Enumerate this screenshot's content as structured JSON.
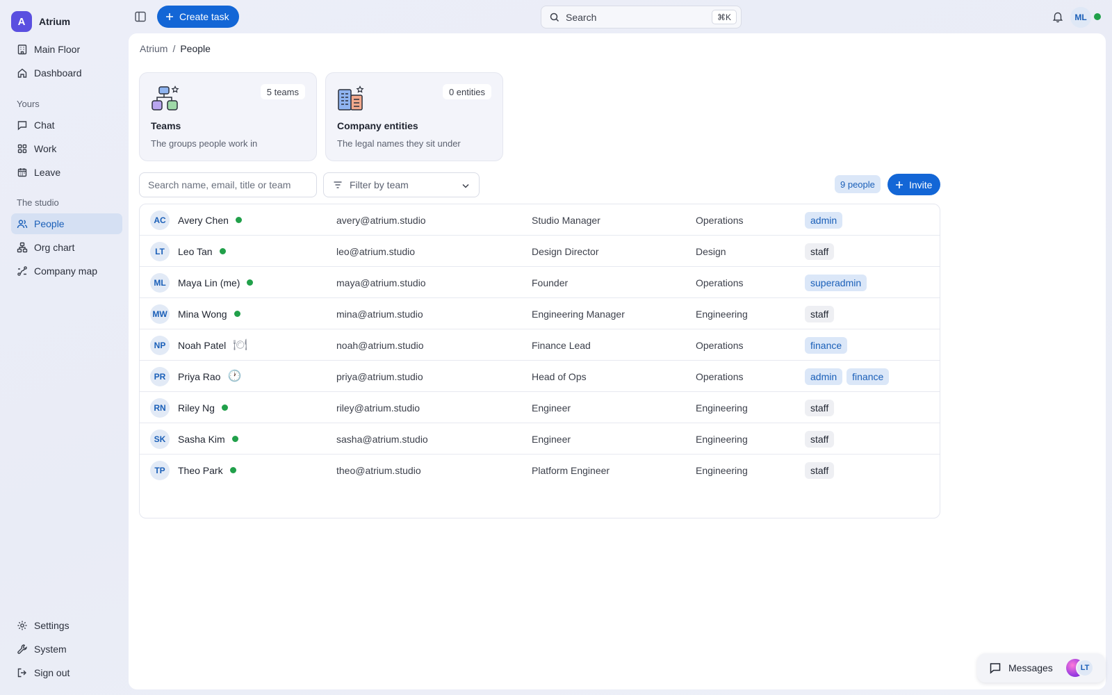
{
  "app": {
    "logo_letter": "A",
    "name": "Atrium"
  },
  "sidebar": {
    "top_items": [
      {
        "label": "Main Floor",
        "icon": "building-icon"
      },
      {
        "label": "Dashboard",
        "icon": "home-icon"
      }
    ],
    "section_yours": "Yours",
    "yours_items": [
      {
        "label": "Chat",
        "icon": "chat-icon"
      },
      {
        "label": "Work",
        "icon": "grid-icon"
      },
      {
        "label": "Leave",
        "icon": "calendar-icon"
      }
    ],
    "section_studio": "The studio",
    "studio_items": [
      {
        "label": "People",
        "icon": "people-icon",
        "active": true
      },
      {
        "label": "Org chart",
        "icon": "org-chart-icon"
      },
      {
        "label": "Company map",
        "icon": "map-icon"
      }
    ],
    "bottom_items": [
      {
        "label": "Settings",
        "icon": "gear-icon"
      },
      {
        "label": "System",
        "icon": "wrench-icon"
      },
      {
        "label": "Sign out",
        "icon": "sign-out-icon"
      }
    ]
  },
  "topbar": {
    "create_label": "Create task",
    "search_label": "Search",
    "search_shortcut": "⌘K",
    "user_initials": "ML"
  },
  "breadcrumb": {
    "root": "Atrium",
    "separator": "/",
    "current": "People"
  },
  "cards": [
    {
      "badge": "5 teams",
      "title": "Teams",
      "subtitle": "The groups people work in"
    },
    {
      "badge": "0 entities",
      "title": "Company entities",
      "subtitle": "The legal names they sit under"
    }
  ],
  "filters": {
    "search_placeholder": "Search name, email, title or team",
    "team_placeholder": "Filter by team"
  },
  "people_count": "9 people",
  "invite_label": "Invite",
  "people": [
    {
      "initials": "AC",
      "name": "Avery Chen",
      "status": "online",
      "email": "avery@atrium.studio",
      "title": "Studio Manager",
      "team": "Operations",
      "roles": [
        {
          "label": "admin",
          "style": "blue"
        }
      ]
    },
    {
      "initials": "LT",
      "name": "Leo Tan",
      "status": "online",
      "email": "leo@atrium.studio",
      "title": "Design Director",
      "team": "Design",
      "roles": [
        {
          "label": "staff",
          "style": "gray"
        }
      ]
    },
    {
      "initials": "ML",
      "name": "Maya Lin (me)",
      "status": "online",
      "email": "maya@atrium.studio",
      "title": "Founder",
      "team": "Operations",
      "roles": [
        {
          "label": "superadmin",
          "style": "blue"
        }
      ]
    },
    {
      "initials": "MW",
      "name": "Mina Wong",
      "status": "online",
      "email": "mina@atrium.studio",
      "title": "Engineering Manager",
      "team": "Engineering",
      "roles": [
        {
          "label": "staff",
          "style": "gray"
        }
      ]
    },
    {
      "initials": "NP",
      "name": "Noah Patel",
      "status": "lunch",
      "status_glyph": "🍽",
      "email": "noah@atrium.studio",
      "title": "Finance Lead",
      "team": "Operations",
      "roles": [
        {
          "label": "finance",
          "style": "blue"
        }
      ]
    },
    {
      "initials": "PR",
      "name": "Priya Rao",
      "status": "away",
      "status_glyph": "🕐",
      "email": "priya@atrium.studio",
      "title": "Head of Ops",
      "team": "Operations",
      "roles": [
        {
          "label": "admin",
          "style": "blue"
        },
        {
          "label": "finance",
          "style": "blue"
        }
      ]
    },
    {
      "initials": "RN",
      "name": "Riley Ng",
      "status": "online",
      "email": "riley@atrium.studio",
      "title": "Engineer",
      "team": "Engineering",
      "roles": [
        {
          "label": "staff",
          "style": "gray"
        }
      ]
    },
    {
      "initials": "SK",
      "name": "Sasha Kim",
      "status": "online",
      "email": "sasha@atrium.studio",
      "title": "Engineer",
      "team": "Engineering",
      "roles": [
        {
          "label": "staff",
          "style": "gray"
        }
      ]
    },
    {
      "initials": "TP",
      "name": "Theo Park",
      "status": "online",
      "email": "theo@atrium.studio",
      "title": "Platform Engineer",
      "team": "Engineering",
      "roles": [
        {
          "label": "staff",
          "style": "gray"
        }
      ]
    }
  ],
  "messages": {
    "label": "Messages",
    "avatar_initials": "LT"
  },
  "colors": {
    "accent": "#1366d6",
    "online": "#21a04a",
    "brand": "#5a4fe0"
  }
}
